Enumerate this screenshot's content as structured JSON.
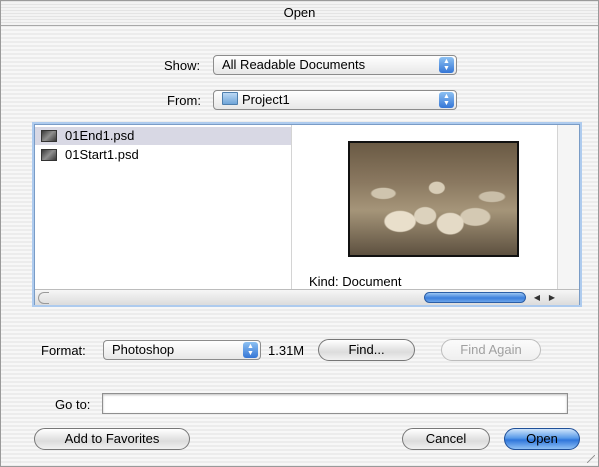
{
  "window": {
    "title": "Open"
  },
  "show": {
    "label": "Show:",
    "value": "All Readable Documents"
  },
  "from": {
    "label": "From:",
    "value": "Project1",
    "icon": "folder-icon"
  },
  "files": [
    {
      "name": "01End1.psd",
      "selected": true,
      "icon": "psd-thumbnail-icon"
    },
    {
      "name": "01Start1.psd",
      "selected": false,
      "icon": "psd-thumbnail-icon"
    }
  ],
  "preview": {
    "kind_text": "Kind: Document"
  },
  "format": {
    "label": "Format:",
    "value": "Photoshop",
    "size": "1.31M"
  },
  "buttons": {
    "find": "Find...",
    "find_again": "Find Again",
    "add_favorites": "Add to Favorites",
    "cancel": "Cancel",
    "open": "Open"
  },
  "goto": {
    "label": "Go to:",
    "value": ""
  },
  "colors": {
    "accent": "#3576d6",
    "selection": "#d8d8e4"
  }
}
